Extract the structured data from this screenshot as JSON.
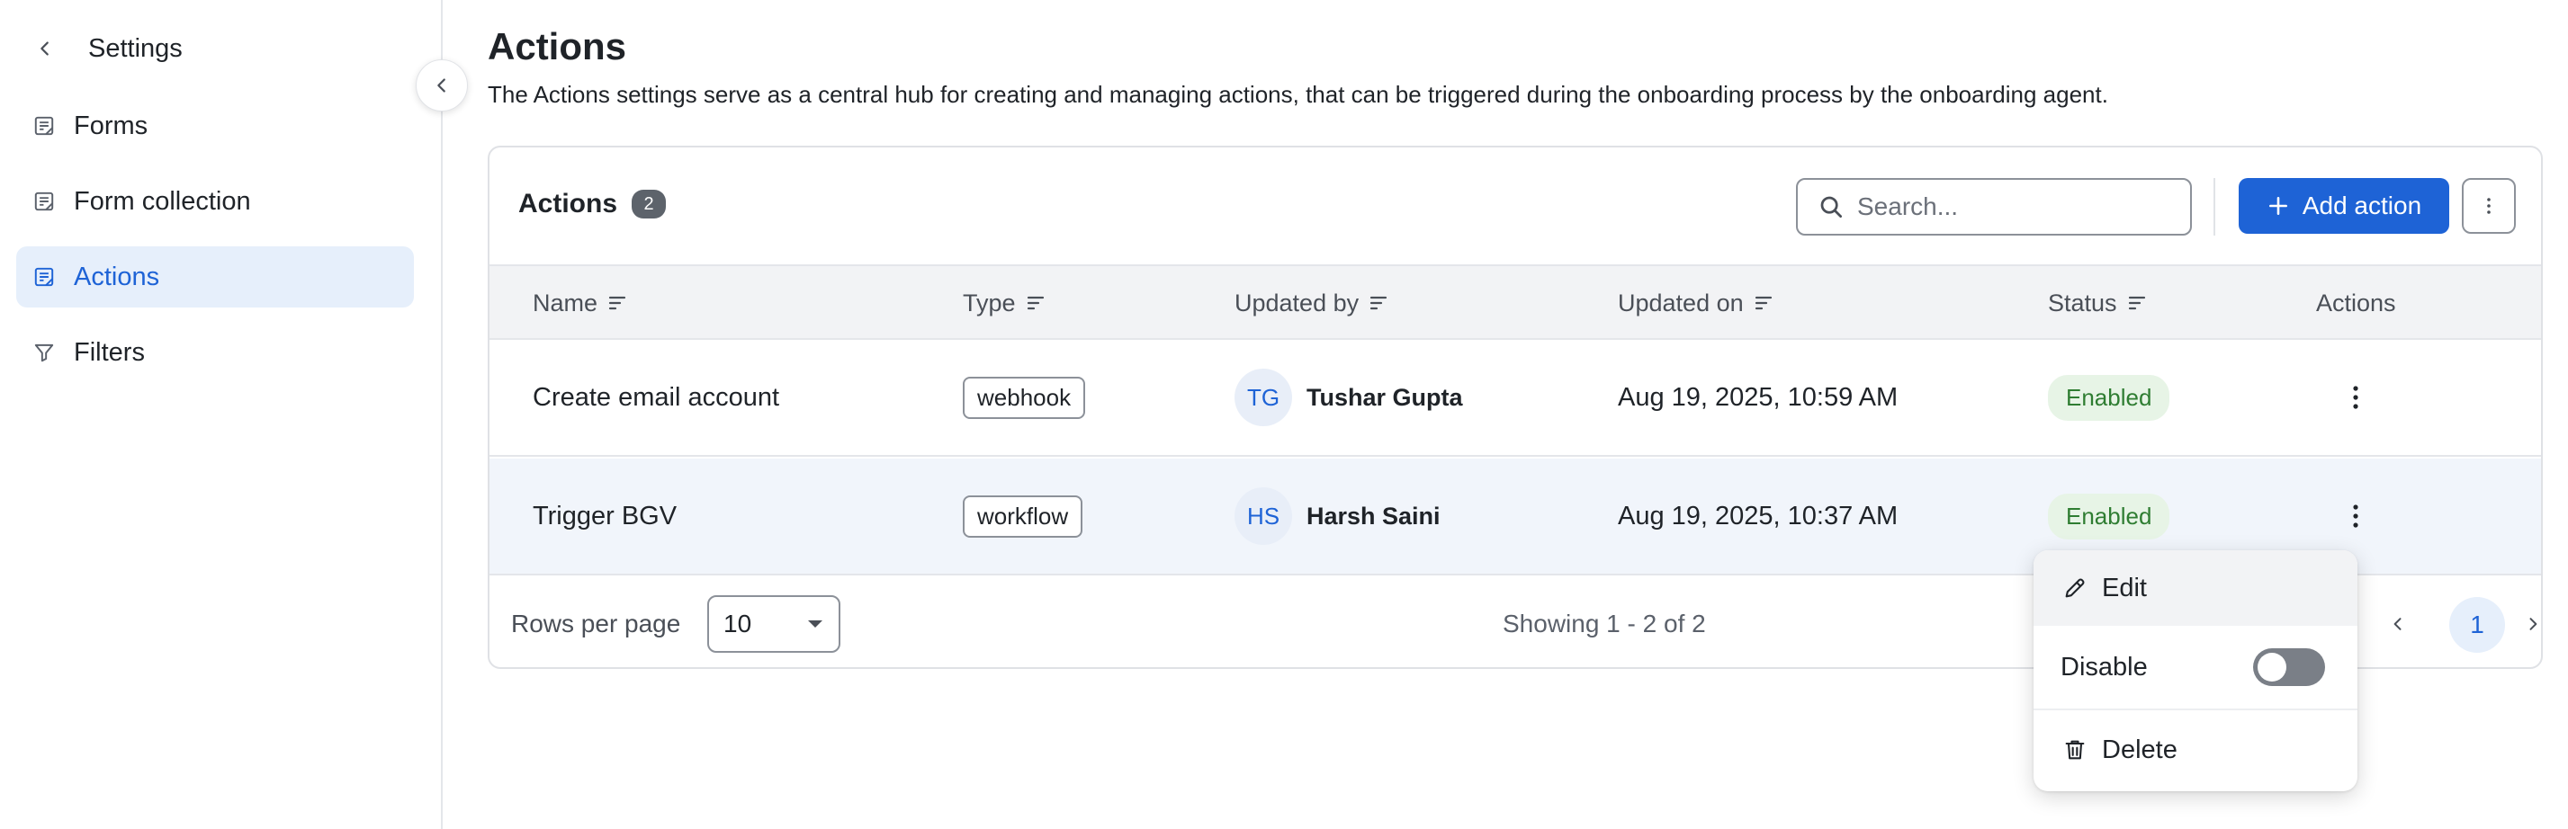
{
  "sidebar": {
    "title": "Settings",
    "items": [
      {
        "label": "Forms",
        "icon": "form-icon",
        "active": false
      },
      {
        "label": "Form collection",
        "icon": "form-icon",
        "active": false
      },
      {
        "label": "Actions",
        "icon": "form-icon",
        "active": true
      },
      {
        "label": "Filters",
        "icon": "filter-icon",
        "active": false
      }
    ]
  },
  "header": {
    "title": "Actions",
    "description": "The Actions settings serve as a central hub for creating and managing actions, that can be triggered during the onboarding process by the onboarding agent."
  },
  "card": {
    "title": "Actions",
    "count": "2",
    "search_placeholder": "Search...",
    "add_button_label": "Add action"
  },
  "table": {
    "columns": [
      "Name",
      "Type",
      "Updated by",
      "Updated on",
      "Status",
      "Actions"
    ],
    "rows": [
      {
        "name": "Create email account",
        "type": "webhook",
        "initials": "TG",
        "updated_by": "Tushar Gupta",
        "updated_on": "Aug 19, 2025, 10:59 AM",
        "status": "Enabled"
      },
      {
        "name": "Trigger BGV",
        "type": "workflow",
        "initials": "HS",
        "updated_by": "Harsh Saini",
        "updated_on": "Aug 19, 2025, 10:37 AM",
        "status": "Enabled"
      }
    ]
  },
  "footer": {
    "rows_per_page_label": "Rows per page",
    "rows_per_page_value": "10",
    "showing_text": "Showing 1 - 2 of 2",
    "current_page": "1"
  },
  "context_menu": {
    "edit_label": "Edit",
    "disable_label": "Disable",
    "disable_toggle_on": false,
    "delete_label": "Delete"
  },
  "colors": {
    "accent": "#1e63d6",
    "active_nav_bg": "#e6effb",
    "status_green_text": "#2f7d32",
    "status_green_bg": "#e7f4e6"
  }
}
